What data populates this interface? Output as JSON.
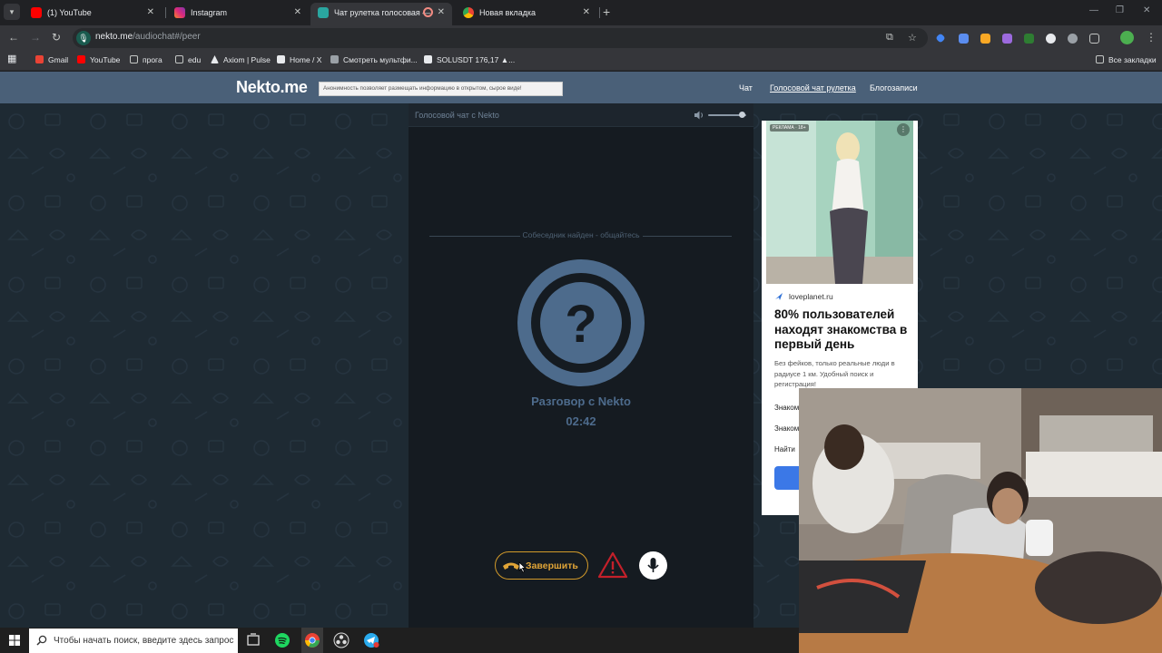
{
  "browser": {
    "tabs": [
      {
        "title": "(1) YouTube",
        "icon": "youtube-icon",
        "color": "#ff0000"
      },
      {
        "title": "Instagram",
        "icon": "instagram-icon",
        "color": "#dd2a7b"
      },
      {
        "title": "Чат рулетка голосовая — ",
        "icon": "nekto-icon",
        "color": "#2aa6a0",
        "active": true
      },
      {
        "title": "Новая вкладка",
        "icon": "chrome-icon",
        "color": "#8ab4f8"
      }
    ],
    "url_host": "nekto.me",
    "url_path": "/audiochat#/peer",
    "bookmarks": [
      {
        "label": "Gmail",
        "icon": "gmail-icon",
        "color": "#ea4335"
      },
      {
        "label": "YouTube",
        "icon": "youtube-icon",
        "color": "#ff0000"
      },
      {
        "label": "прога",
        "icon": "folder-icon",
        "color": "#c4c7c5"
      },
      {
        "label": "edu",
        "icon": "folder-icon",
        "color": "#c4c7c5"
      },
      {
        "label": "Axiom | Pulse",
        "icon": "axiom-icon",
        "color": "#e8eaed"
      },
      {
        "label": "Home / X",
        "icon": "x-icon",
        "color": "#e8eaed"
      },
      {
        "label": "Смотреть мультфи...",
        "icon": "film-icon",
        "color": "#9aa0a6"
      },
      {
        "label": "SOLUSDT 176,17 ▲...",
        "icon": "tradingview-icon",
        "color": "#e8eaed"
      }
    ],
    "all_bookmarks": "Все закладки"
  },
  "site": {
    "logo": "Nekto.me",
    "notice": "Анонимность позволяет размещать информацию в открытом, сырое виде!",
    "nav": [
      {
        "label": "Чат",
        "selected": false
      },
      {
        "label": "Голосовой чат рулетка",
        "selected": true
      },
      {
        "label": "Блогозаписи",
        "selected": false
      }
    ]
  },
  "chat": {
    "header": "Голосовой чат с Nekto",
    "volume": 0.88,
    "status": "Собеседник найден - общайтесь",
    "avatar_symbol": "?",
    "peer_name": "Разговор с Nekto",
    "timer": "02:42",
    "end_button": "Завершить",
    "accent": "#d29a2a",
    "avatar_color": "#4d6b8c"
  },
  "ad": {
    "badge": "РЕКЛАМА · 18+",
    "domain": "loveplanet.ru",
    "headline": "80% пользователей находят знакомства в первый день",
    "description": "Без фейков, только реальные люди в радиусе 1 км. Удобный поиск и регистрация!",
    "links": [
      "Знаком",
      "Знаком",
      "Найти"
    ]
  },
  "taskbar": {
    "search_placeholder": "Чтобы начать поиск, введите здесь запрос",
    "apps": [
      "task-view-icon",
      "spotify-icon",
      "chrome-icon",
      "obs-icon",
      "telegram-icon"
    ]
  }
}
